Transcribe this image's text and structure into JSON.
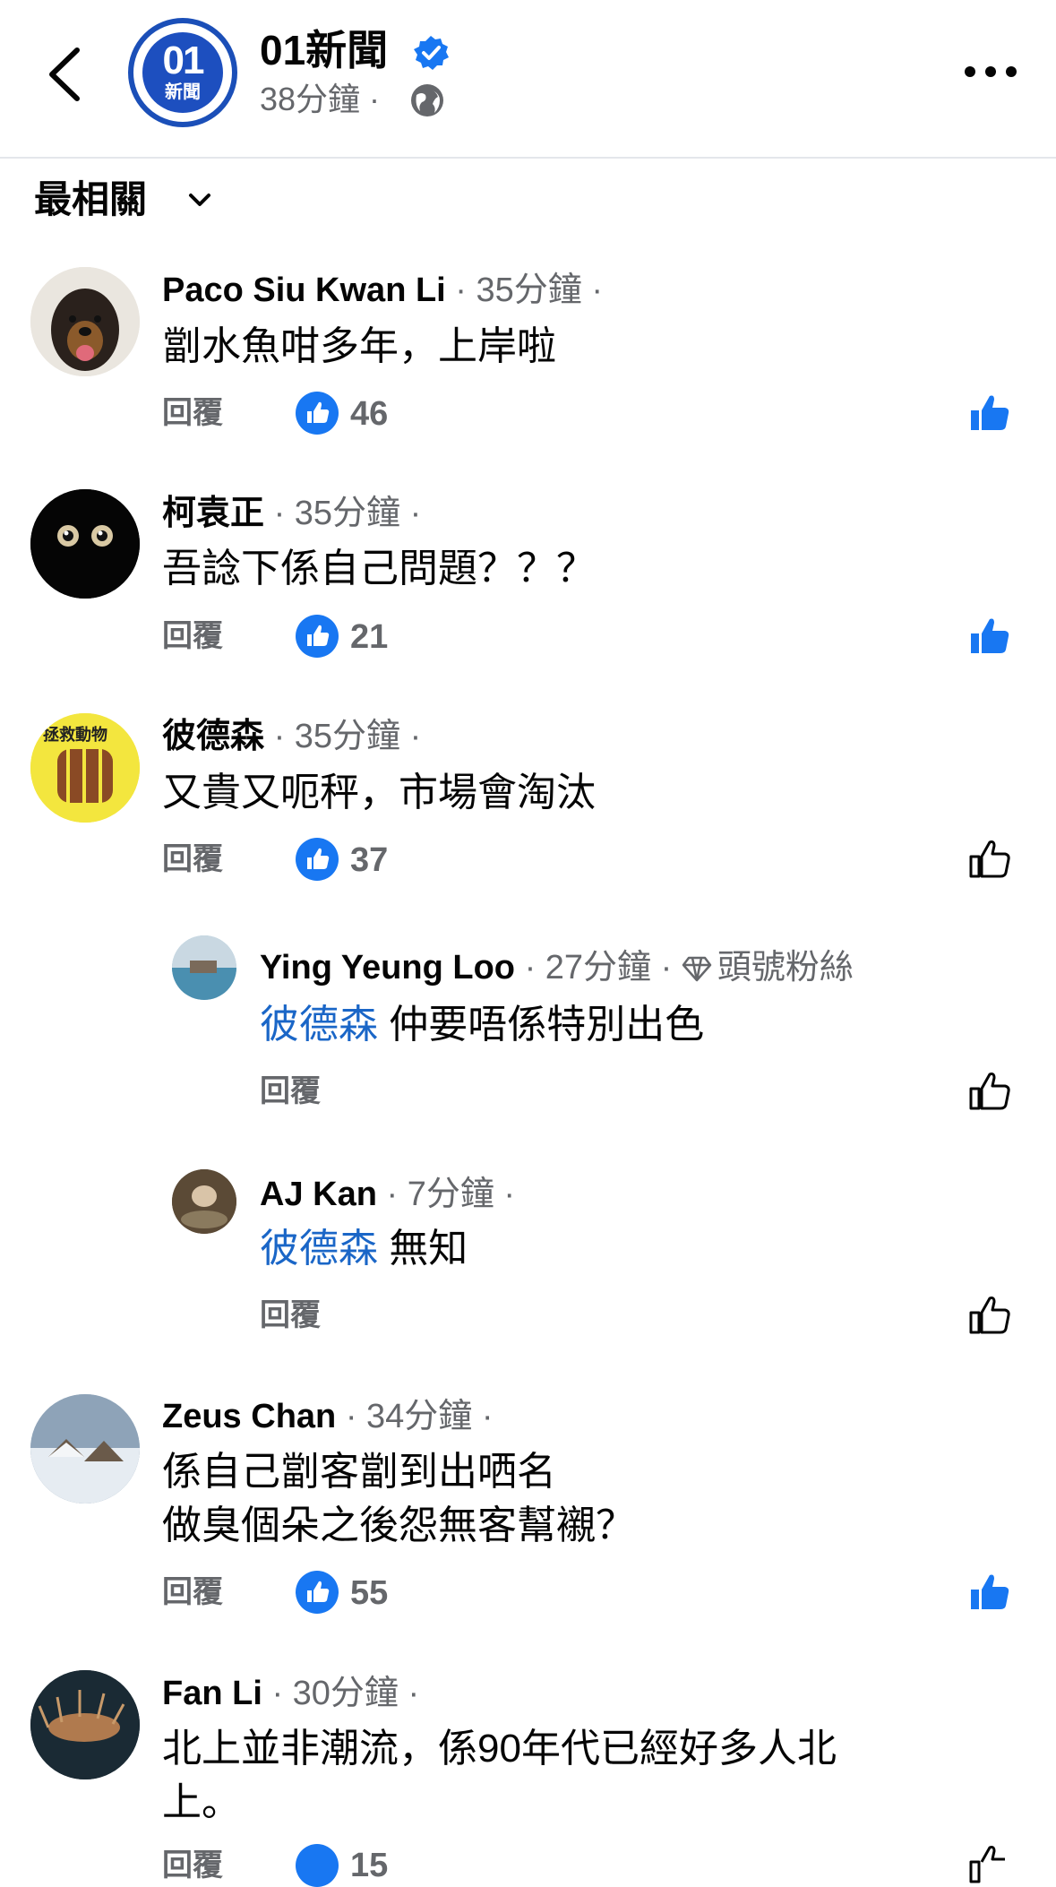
{
  "header": {
    "page_name": "01新聞",
    "logo_number": "01",
    "logo_text": "新聞",
    "time": "38分鐘 ·",
    "back_icon": "chevron-left-icon",
    "more_icon": "more-horizontal-icon",
    "globe_icon": "globe-icon",
    "verified_icon": "verified-badge-icon"
  },
  "sort": {
    "label": "最相關"
  },
  "labels": {
    "reply": "回覆"
  },
  "colors": {
    "accent": "#1877f2",
    "mention": "#1a66c7",
    "secondary_text": "#65676b",
    "logo_blue": "#1d4fbf"
  },
  "comments": [
    {
      "name": "Paco Siu Kwan Li",
      "meta": "· 35分鐘 ·",
      "text": "劏水魚咁多年，上岸啦",
      "likes": "46",
      "liked": true
    },
    {
      "name": "柯袁正",
      "meta": "· 35分鐘 ·",
      "text": "吾諗下係自己問題？？？",
      "likes": "21",
      "liked": true
    },
    {
      "name": "彼德森",
      "meta": "· 35分鐘 ·",
      "text": "又貴又呃秤，市場會淘汰",
      "likes": "37",
      "liked": false
    }
  ],
  "replies": [
    {
      "name": "Ying Yeung Loo",
      "meta": "· 27分鐘 ·",
      "badge": "頭號粉絲",
      "mention": "彼德森",
      "text": " 仲要唔係特別出色"
    },
    {
      "name": "AJ Kan",
      "meta": "· 7分鐘 ·",
      "mention": "彼德森",
      "text": " 無知"
    }
  ],
  "comments2": [
    {
      "name": "Zeus Chan",
      "meta": "· 34分鐘 ·",
      "line1": "係自己劏客劏到出哂名",
      "line2": "做臭個朵之後怨無客幫襯？",
      "likes": "55",
      "liked": true
    },
    {
      "name": "Fan Li",
      "meta": "· 30分鐘 ·",
      "line1": "北上並非潮流，係90年代已經好多人北",
      "line2": "上。",
      "likes": "15"
    }
  ]
}
